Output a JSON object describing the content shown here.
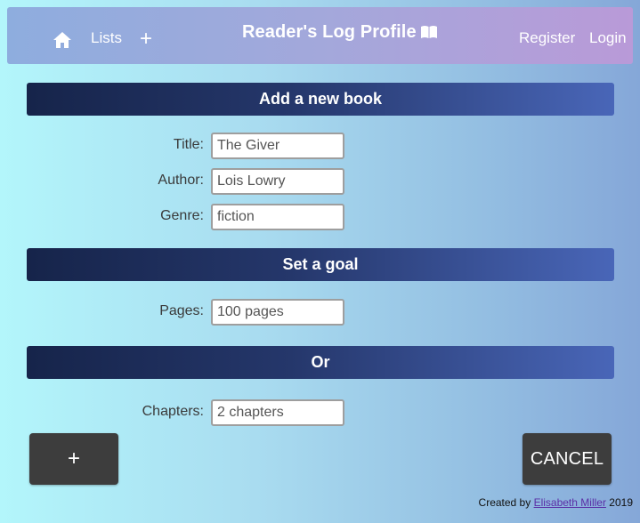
{
  "nav": {
    "home_icon": "home-icon",
    "lists_label": "Lists",
    "add_label": "+",
    "title": "Reader's Log Profile",
    "title_icon": "open-book-icon",
    "register_label": "Register",
    "login_label": "Login"
  },
  "sections": {
    "add_book": "Add a new book",
    "goal": "Set a goal",
    "or": "Or"
  },
  "form": {
    "title_label": "Title:",
    "title_value": "The Giver",
    "author_label": "Author:",
    "author_value": "Lois Lowry",
    "genre_label": "Genre:",
    "genre_value": "fiction",
    "pages_label": "Pages:",
    "pages_value": "100 pages",
    "chapters_label": "Chapters:",
    "chapters_value": "2 chapters"
  },
  "buttons": {
    "add_label": "+",
    "cancel_label": "CANCEL"
  },
  "footer": {
    "prefix": "Created by",
    "author_link": "Elisabeth Miller",
    "year": "2019"
  },
  "colors": {
    "section_bar": "#25376b",
    "button": "#3d3d3d",
    "link": "#5a2ea6"
  }
}
